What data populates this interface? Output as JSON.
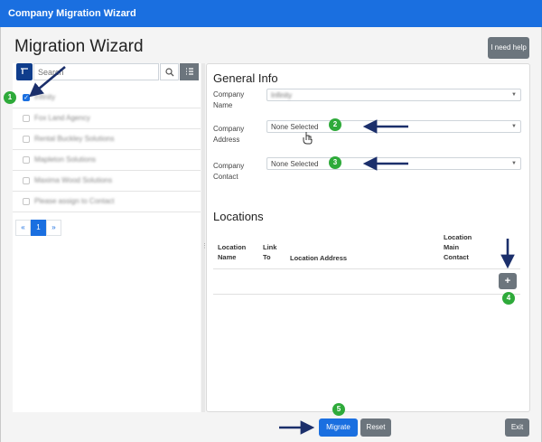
{
  "window": {
    "title": "Company Migration Wizard"
  },
  "header": {
    "page_title": "Migration Wizard",
    "help_label": "I need help"
  },
  "sidebar": {
    "search_placeholder": "Search",
    "items": [
      {
        "label": "Infinity",
        "checked": true
      },
      {
        "label": "Fox Land Agency",
        "checked": false
      },
      {
        "label": "Rental Buckley Solutions",
        "checked": false
      },
      {
        "label": "Mapleton Solutions",
        "checked": false
      },
      {
        "label": "Maxima Wood Solutions",
        "checked": false
      },
      {
        "label": "Please assign to Contact",
        "checked": false
      }
    ],
    "pagination": {
      "prev": "«",
      "current": "1",
      "next": "»"
    }
  },
  "general_info": {
    "heading": "General Info",
    "company_name_label": "Company Name",
    "company_name_value": "Infinity",
    "company_address_label": "Company Address",
    "company_address_value": "None Selected",
    "company_contact_label": "Company Contact",
    "company_contact_value": "None Selected"
  },
  "locations": {
    "heading": "Locations",
    "columns": [
      "Location Name",
      "Link To",
      "Location Address",
      "Location Main Contact"
    ],
    "add_label": "+"
  },
  "footer": {
    "migrate_label": "Migrate",
    "reset_label": "Reset",
    "exit_label": "Exit"
  },
  "annotations": [
    "1",
    "2",
    "3",
    "4",
    "5"
  ],
  "colors": {
    "accent": "#1a6fe0",
    "secondary": "#6c757d",
    "badge": "#2eaa3a",
    "arrow": "#1b2f6b",
    "filter": "#0f3d8c"
  }
}
